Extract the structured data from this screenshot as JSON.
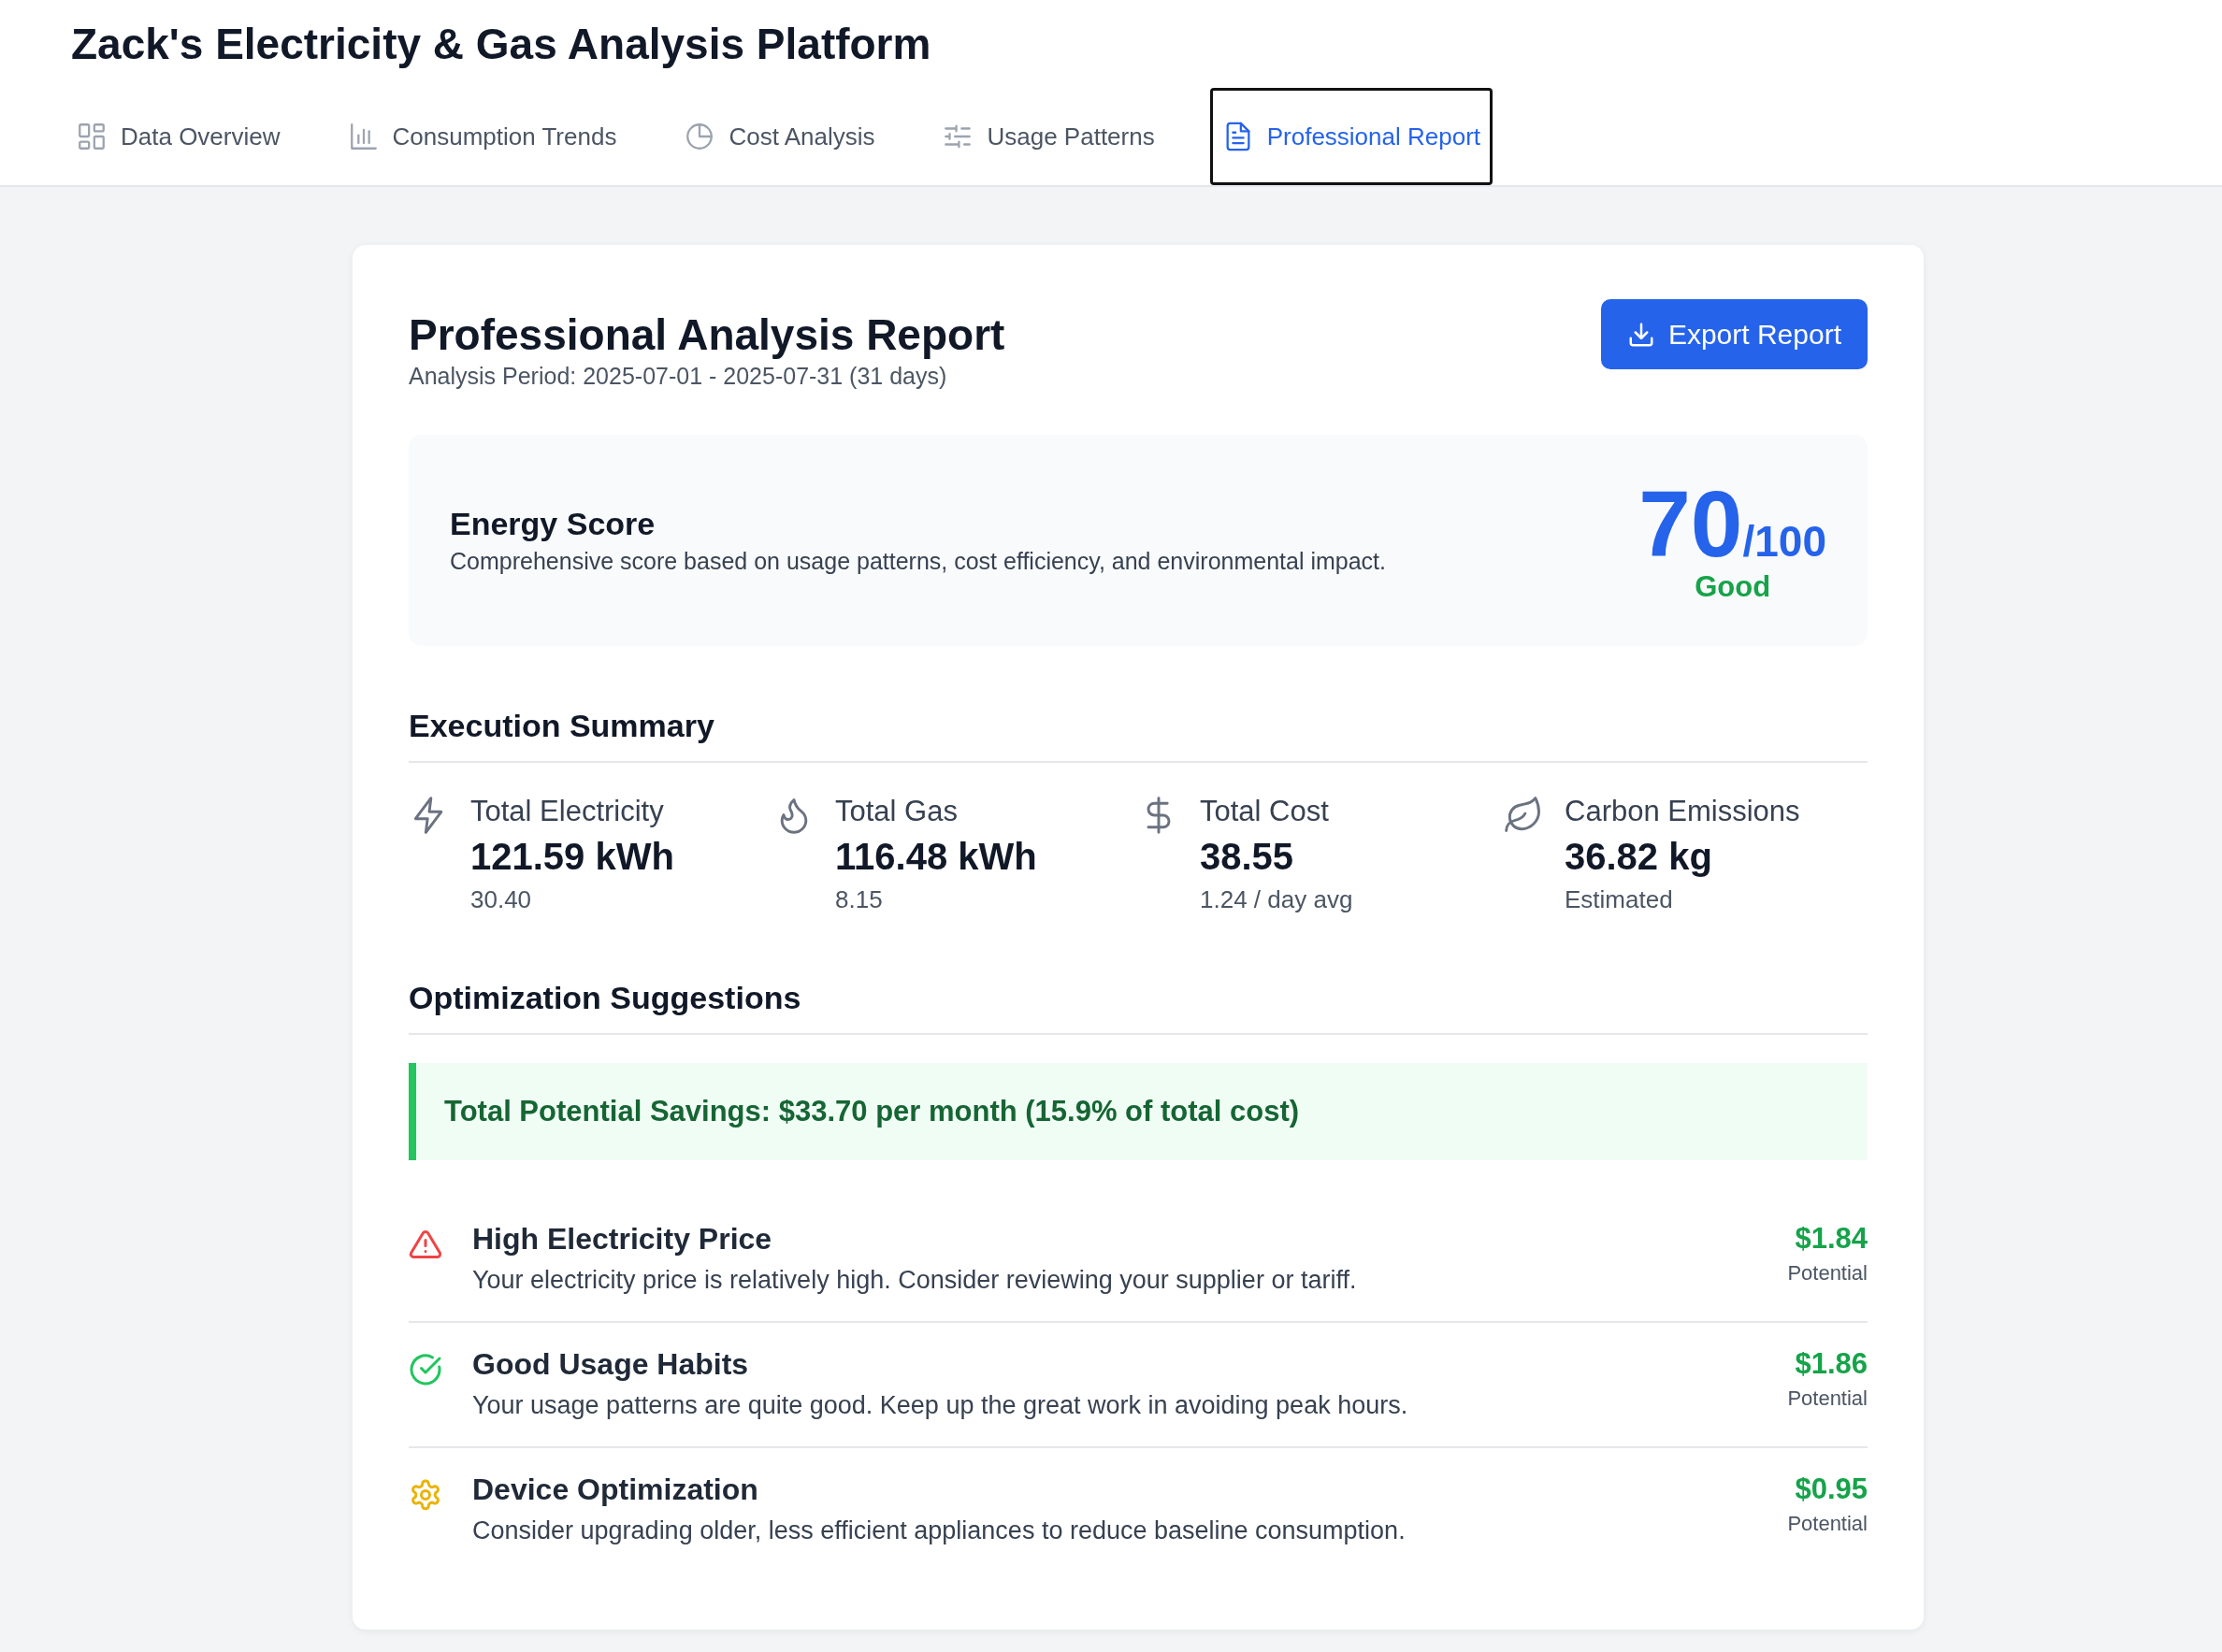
{
  "app_title": "Zack's Electricity & Gas Analysis Platform",
  "tabs": [
    {
      "label": "Data Overview",
      "kind": "grid",
      "selected": false
    },
    {
      "label": "Consumption Trends",
      "kind": "bars",
      "selected": false
    },
    {
      "label": "Cost Analysis",
      "kind": "pie",
      "selected": false
    },
    {
      "label": "Usage Patterns",
      "kind": "sliders",
      "selected": false
    },
    {
      "label": "Professional Report",
      "kind": "document",
      "selected": true
    }
  ],
  "report": {
    "title": "Professional Analysis Report",
    "period": "Analysis Period: 2025-07-01 - 2025-07-31 (31 days)",
    "export_button": "Export Report"
  },
  "energy_score": {
    "title": "Energy Score",
    "description": "Comprehensive score based on usage patterns, cost efficiency, and environmental impact.",
    "score": "70",
    "max": "/100",
    "rating": "Good"
  },
  "summary": {
    "heading": "Execution Summary",
    "stats": [
      {
        "kind": "electricity",
        "label": "Total Electricity",
        "value": "121.59 kWh",
        "sub": "30.40"
      },
      {
        "kind": "gas",
        "label": "Total Gas",
        "value": "116.48 kWh",
        "sub": "8.15"
      },
      {
        "kind": "cost",
        "label": "Total Cost",
        "value": "38.55",
        "sub": "1.24 / day avg"
      },
      {
        "kind": "carbon",
        "label": "Carbon Emissions",
        "value": "36.82 kg",
        "sub": "Estimated"
      }
    ]
  },
  "suggestions": {
    "heading": "Optimization Suggestions",
    "savings": "Total Potential Savings: $33.70 per month (15.9% of total cost)",
    "items": [
      {
        "kind": "warning",
        "title": "High Electricity Price",
        "description": "Your electricity price is relatively high. Consider reviewing your supplier or tariff.",
        "amount": "$1.84",
        "amount_label": "Potential"
      },
      {
        "kind": "success",
        "title": "Good Usage Habits",
        "description": "Your usage patterns are quite good. Keep up the great work in avoiding peak hours.",
        "amount": "$1.86",
        "amount_label": "Potential"
      },
      {
        "kind": "device",
        "title": "Device Optimization",
        "description": "Consider upgrading older, less efficient appliances to reduce baseline consumption.",
        "amount": "$0.95",
        "amount_label": "Potential"
      }
    ]
  }
}
